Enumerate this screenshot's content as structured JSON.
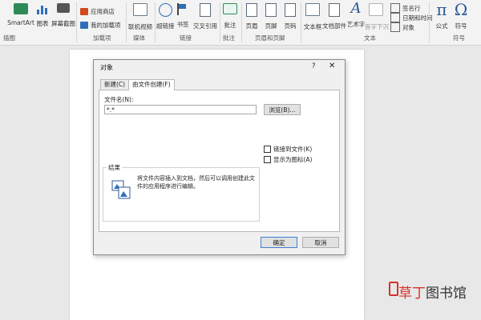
{
  "ribbon": {
    "smartart_label": "SmartArt",
    "chart_label": "图表",
    "screenshot_label": "屏幕截图",
    "illustrations_group": "插图",
    "app_store_label": "应用商店",
    "my_addins_label": "我的加载项",
    "addins_group": "加载项",
    "online_video_label": "联机视频",
    "media_group": "媒体",
    "hyperlink_label": "超链接",
    "bookmark_label": "书签",
    "crossref_label": "交叉引用",
    "links_group": "链接",
    "comment_label": "批注",
    "comments_group": "批注",
    "header_label": "页眉",
    "footer_label": "页脚",
    "pagenum_label": "页码",
    "headerfooter_group": "页眉和页脚",
    "textbox_label": "文本框",
    "docparts_label": "文档部件",
    "wordart_label": "艺术字",
    "dropcap_label": "首字下沉",
    "signature_label": "签名行",
    "datetime_label": "日期和时间",
    "object_label": "对象",
    "text_group": "文本",
    "equation_label": "公式",
    "symbol_label": "符号",
    "symbols_group": "符号",
    "pi": "π",
    "omega": "Ω"
  },
  "dialog": {
    "title": "对象",
    "help": "?",
    "close": "✕",
    "tab_new": "新建(C)",
    "tab_from_file": "由文件创建(F)",
    "filename_label": "文件名(N):",
    "filename_value": "*.*",
    "browse_label": "浏览(B)...",
    "link_to_file": "链接到文件(K)",
    "display_as_icon": "显示为图标(A)",
    "result_title": "结果",
    "result_text": "将文件内容插入到文档，然后可以调用创建此文件的应用程序进行编辑。",
    "ok_label": "确定",
    "cancel_label": "取消"
  },
  "watermark": {
    "text_red": "草丁",
    "text_dark": "图书馆"
  }
}
